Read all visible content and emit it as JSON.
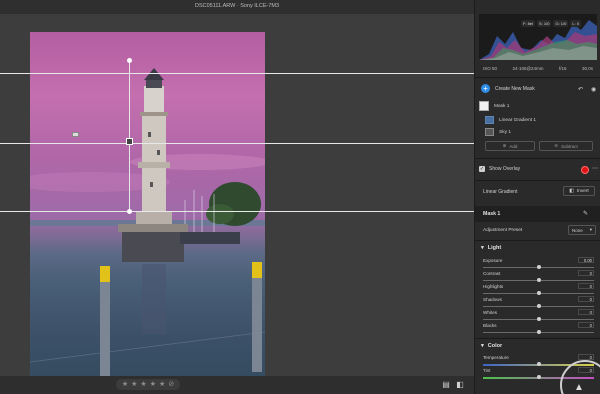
{
  "window": {
    "title": "DSC05111.ARW  ·  Sony ILCE-7M3",
    "icons": [
      "export-icon",
      "settings-icon"
    ]
  },
  "histogram": {
    "badges": [
      "F: 8el",
      "S: 1/0",
      "G: 1/0",
      "L: 0"
    ]
  },
  "exif": {
    "iso": "ISO 50",
    "lens": "24-105@24mm",
    "aperture": "f/16",
    "shutter": "30,0s"
  },
  "masks": {
    "create_label": "Create New Mask",
    "items": [
      {
        "label": "Mask 1",
        "level": 0
      },
      {
        "label": "Linear Gradient 1",
        "level": 1
      },
      {
        "label": "Sky 1",
        "level": 1
      }
    ],
    "add_label": "Add",
    "subtract_label": "Subtract",
    "show_overlay_label": "Show Overlay",
    "overlay_color": "#e01414"
  },
  "gradient": {
    "label": "Linear Gradient",
    "invert_label": "Invert"
  },
  "mask_panel": {
    "title": "Mask 1",
    "preset_label": "Adjustment Preset",
    "preset_value": "None"
  },
  "light": {
    "title": "Light",
    "sliders": [
      {
        "name": "Exposure",
        "value": "0.00",
        "pos": 0.5
      },
      {
        "name": "Contrast",
        "value": "0",
        "pos": 0.5
      },
      {
        "name": "Highlights",
        "value": "0",
        "pos": 0.5
      },
      {
        "name": "Shadows",
        "value": "0",
        "pos": 0.5
      },
      {
        "name": "Whites",
        "value": "0",
        "pos": 0.5
      },
      {
        "name": "Blacks",
        "value": "0",
        "pos": 0.5
      }
    ]
  },
  "color": {
    "title": "Color",
    "sliders": [
      {
        "name": "Temperature",
        "value": "0",
        "pos": 0.5
      },
      {
        "name": "Tint",
        "value": "0",
        "pos": 0.5
      }
    ]
  },
  "rating": {
    "stars": 5,
    "filled": 0
  },
  "colors": {
    "accent": "#2e8de8",
    "panel": "#2a2a2a",
    "canvas": "#3d3d3d"
  }
}
